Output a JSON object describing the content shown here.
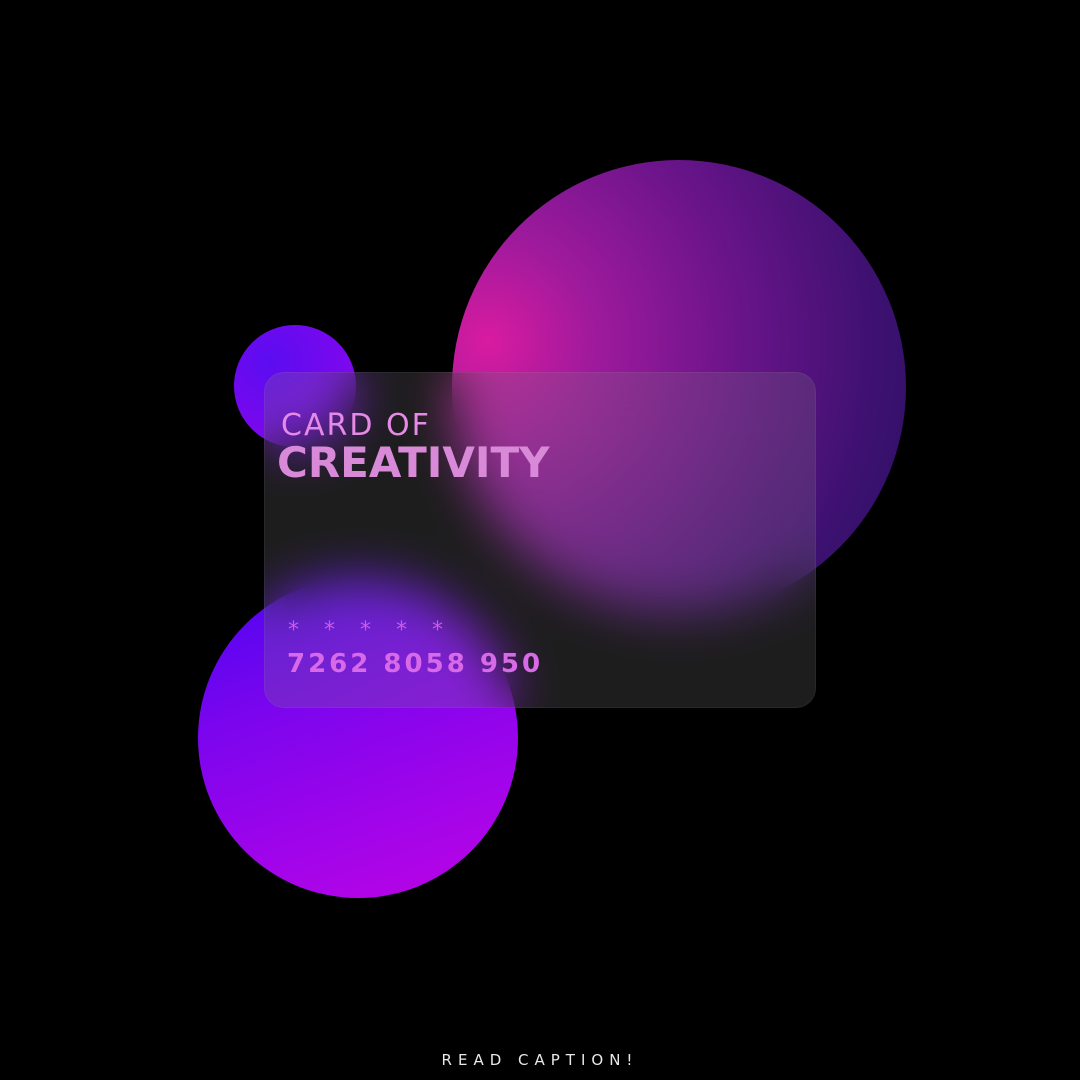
{
  "card": {
    "subtitle": "CARD OF",
    "title": "CREATIVITY",
    "masked_digits": "* * * * *",
    "number": "7262 8058 950"
  },
  "caption": "READ CAPTION!",
  "colors": {
    "background": "#000000",
    "accent_pink": "#d81ba0",
    "accent_violet": "#7a05ee",
    "accent_indigo": "#251063",
    "card_text": "#d86ae8"
  }
}
